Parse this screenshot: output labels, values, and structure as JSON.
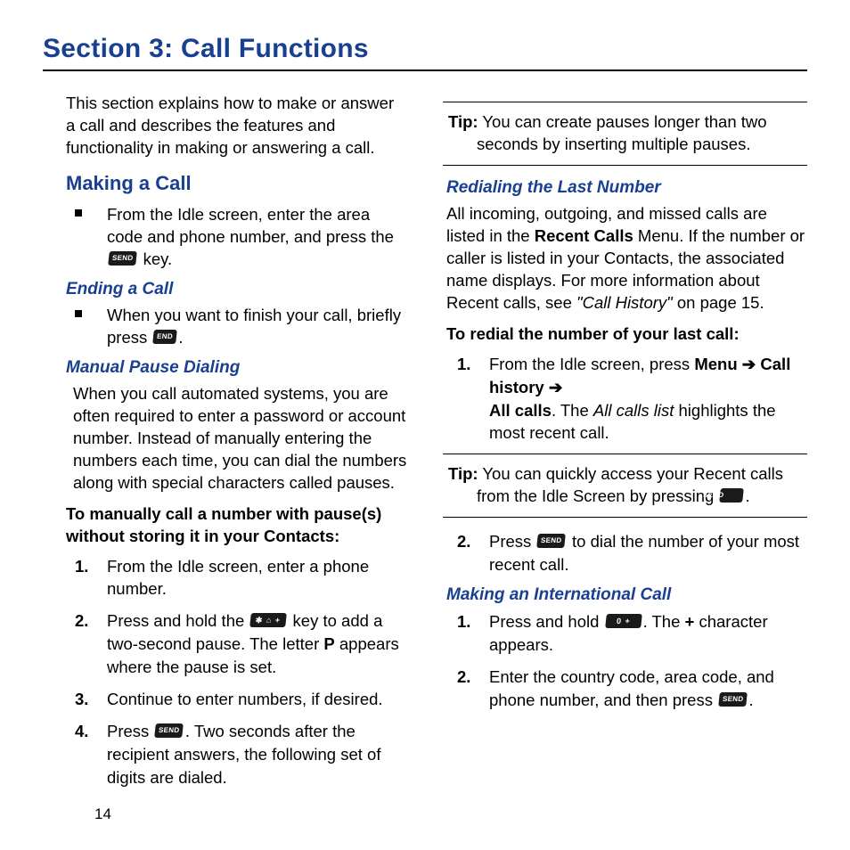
{
  "section_title": "Section 3: Call Functions",
  "page_number": "14",
  "left": {
    "intro": "This section explains how to make or answer a call and describes the features and functionality in making or answering a call.",
    "making_h2": "Making a Call",
    "making_bullet_a": "From the Idle screen, enter the area code and phone number, and press the ",
    "making_bullet_b": " key.",
    "ending_h3": "Ending a Call",
    "ending_bullet_a": "When you want to finish your call, briefly press ",
    "ending_bullet_b": ".",
    "mpd_h3": "Manual Pause Dialing",
    "mpd_body": "When you call automated systems, you are often required to enter a password or account number. Instead of manually entering the numbers each time, you can dial the numbers along with special characters called pauses.",
    "mpd_lead": "To manually call a number with pause(s) without storing it in your Contacts:",
    "mpd_step1": "From the Idle screen, enter a phone number.",
    "mpd_step2_a": "Press and hold the ",
    "mpd_step2_b": " key to add a two-second pause. The letter ",
    "mpd_step2_c": " appears where the pause is set.",
    "mpd_step2_p": "P",
    "mpd_step3": "Continue to enter numbers, if desired.",
    "mpd_step4_a": "Press ",
    "mpd_step4_b": ". Two seconds after the recipient answers, the following set of digits are dialed."
  },
  "right": {
    "tip1_label": "Tip:",
    "tip1_body": " You can create pauses longer than two seconds by inserting multiple pauses.",
    "redial_h3": "Redialing the Last Number",
    "redial_body_a": "All incoming, outgoing, and missed calls are listed in the ",
    "redial_body_recent": "Recent Calls",
    "redial_body_b": " Menu. If the number or caller is listed in your Contacts, the associated name displays. For more information about Recent calls, see ",
    "redial_body_ref": "\"Call History\"",
    "redial_body_c": " on page 15.",
    "redial_lead": "To redial the number of your last call:",
    "redial_step1_a": "From the Idle screen, press ",
    "redial_step1_menu": "Menu",
    "redial_step1_arrow": " ➔ ",
    "redial_step1_call": "Call history",
    "redial_step1_arrow2": " ➔",
    "redial_step1_all": "All calls",
    "redial_step1_b": ". The ",
    "redial_step1_list": "All calls list",
    "redial_step1_c": " highlights the most recent call.",
    "tip2_label": "Tip:",
    "tip2_body_a": " You can quickly access your Recent calls from the Idle Screen by pressing ",
    "tip2_body_b": ".",
    "redial_step2_a": "Press ",
    "redial_step2_b": " to dial the number of your most recent call.",
    "intl_h3": "Making an International Call",
    "intl_step1_a": "Press and hold ",
    "intl_step1_b": ". The ",
    "intl_step1_plus": "+",
    "intl_step1_c": " character appears.",
    "intl_step2_a": "Enter the country code, area code, and phone number, and then press ",
    "intl_step2_b": "."
  },
  "keys": {
    "send": "SEND",
    "end": "END",
    "star": "✱ ⌂ +",
    "zero": "0  +"
  }
}
